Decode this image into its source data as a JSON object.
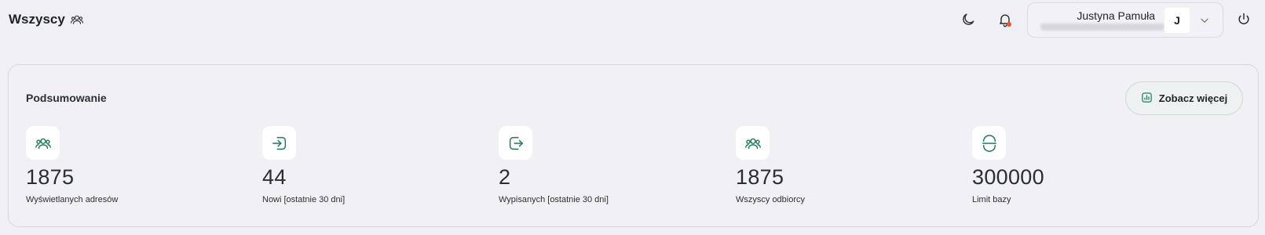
{
  "header": {
    "title": "Wszyscy",
    "title_icon": "users-icon",
    "theme_icon": "moon-icon",
    "notification_icon": "bell-icon",
    "notification_dot_color": "#e4572e",
    "power_icon": "power-icon"
  },
  "user": {
    "name": "Justyna Pamuła",
    "avatar_initial": "J",
    "menu_icon": "chevron-down-icon"
  },
  "summary": {
    "title": "Podsumowanie",
    "more_button_label": "Zobacz więcej",
    "more_button_icon": "chart-icon",
    "accent_color": "#1f7a57",
    "stats": [
      {
        "icon": "users-icon",
        "value": "1875",
        "label": "Wyświetlanych adresów"
      },
      {
        "icon": "sign-in-icon",
        "value": "44",
        "label": "Nowi [ostatnie 30 dni]"
      },
      {
        "icon": "sign-out-icon",
        "value": "2",
        "label": "Wypisanych [ostatnie 30 dni]"
      },
      {
        "icon": "users-icon",
        "value": "1875",
        "label": "Wszyscy odbiorcy"
      },
      {
        "icon": "limit-icon",
        "value": "300000",
        "label": "Limit bazy"
      }
    ]
  }
}
